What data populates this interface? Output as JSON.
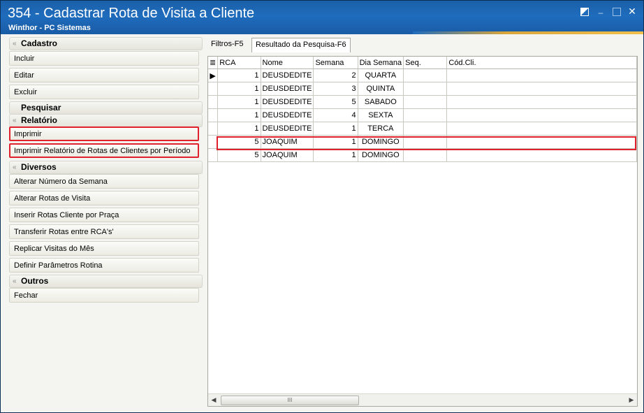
{
  "window": {
    "title": "354 - Cadastrar Rota de Visita a Cliente",
    "subtitle": "Winthor - PC Sistemas",
    "controls": {
      "restore": "restore-icon",
      "minimize": "–",
      "maximize": "maximize-icon",
      "close": "✕"
    }
  },
  "sidebar": {
    "cadastro": {
      "title": "Cadastro",
      "items": [
        "Incluir",
        "Editar",
        "Excluir"
      ]
    },
    "pesquisar": {
      "title": "Pesquisar"
    },
    "relatorio": {
      "title": "Relatório",
      "items": [
        "Imprimir",
        "Imprimir Relatório de Rotas de Clientes por Período"
      ]
    },
    "diversos": {
      "title": "Diversos",
      "items": [
        "Alterar Número da Semana",
        "Alterar Rotas de Visita",
        "Inserir Rotas Cliente por Praça",
        "Transferir Rotas entre RCA's'",
        "Replicar Visitas do Mês",
        "Definir Parâmetros Rotina"
      ]
    },
    "outros": {
      "title": "Outros",
      "items": [
        "Fechar"
      ]
    },
    "chevron": "«"
  },
  "tabs": [
    {
      "label": "Filtros-F5"
    },
    {
      "label": "Resultado da Pesquisa-F6",
      "active": true
    }
  ],
  "grid": {
    "columns": [
      "RCA",
      "Nome",
      "Semana",
      "Dia Semana",
      "Seq.",
      "Cód.Cli."
    ],
    "rows": [
      [
        "1",
        "DEUSDEDITE",
        "2",
        "QUARTA",
        "",
        ""
      ],
      [
        "1",
        "DEUSDEDITE",
        "3",
        "QUINTA",
        "",
        ""
      ],
      [
        "1",
        "DEUSDEDITE",
        "5",
        "SABADO",
        "",
        ""
      ],
      [
        "1",
        "DEUSDEDITE",
        "4",
        "SEXTA",
        "",
        ""
      ],
      [
        "1",
        "DEUSDEDITE",
        "1",
        "TERCA",
        "",
        ""
      ],
      [
        "5",
        "JOAQUIM",
        "1",
        "DOMINGO",
        "",
        ""
      ],
      [
        "5",
        "JOAQUIM",
        "1",
        "DOMINGO",
        "",
        ""
      ]
    ],
    "scroll_thumb": "III"
  }
}
